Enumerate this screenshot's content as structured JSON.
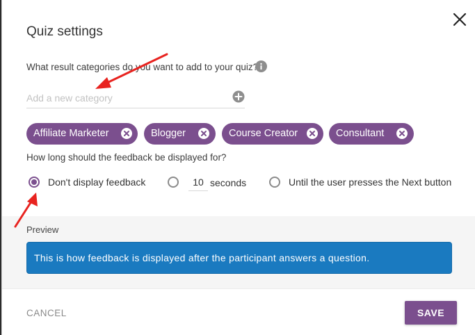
{
  "dialog": {
    "title": "Quiz settings",
    "close_icon": "close-icon"
  },
  "categories": {
    "question": "What result categories do you want to add to your quiz?",
    "info_icon": "info-icon",
    "input_placeholder": "Add a new category",
    "input_value": "",
    "add_icon": "plus-circle-icon",
    "chips": [
      {
        "label": "Affiliate Marketer",
        "remove_icon": "close-circle-icon"
      },
      {
        "label": "Blogger",
        "remove_icon": "close-circle-icon"
      },
      {
        "label": "Course Creator",
        "remove_icon": "close-circle-icon"
      },
      {
        "label": "Consultant",
        "remove_icon": "close-circle-icon"
      }
    ]
  },
  "feedback_duration": {
    "question": "How long should the feedback be displayed for?",
    "options": [
      {
        "label": "Don't display feedback",
        "checked": true
      },
      {
        "label": "seconds",
        "checked": false,
        "value": "10"
      },
      {
        "label": "Until the user presses the Next button",
        "checked": false
      }
    ]
  },
  "preview": {
    "label": "Preview",
    "feedback_text": "This is how feedback is displayed after the participant answers a question."
  },
  "footer": {
    "cancel_label": "CANCEL",
    "save_label": "SAVE"
  },
  "colors": {
    "accent": "#7b4f8e",
    "feedback_bg": "#1a7ac0",
    "annotation_arrow": "#e8231f",
    "preview_bg": "#f5f5f5"
  }
}
